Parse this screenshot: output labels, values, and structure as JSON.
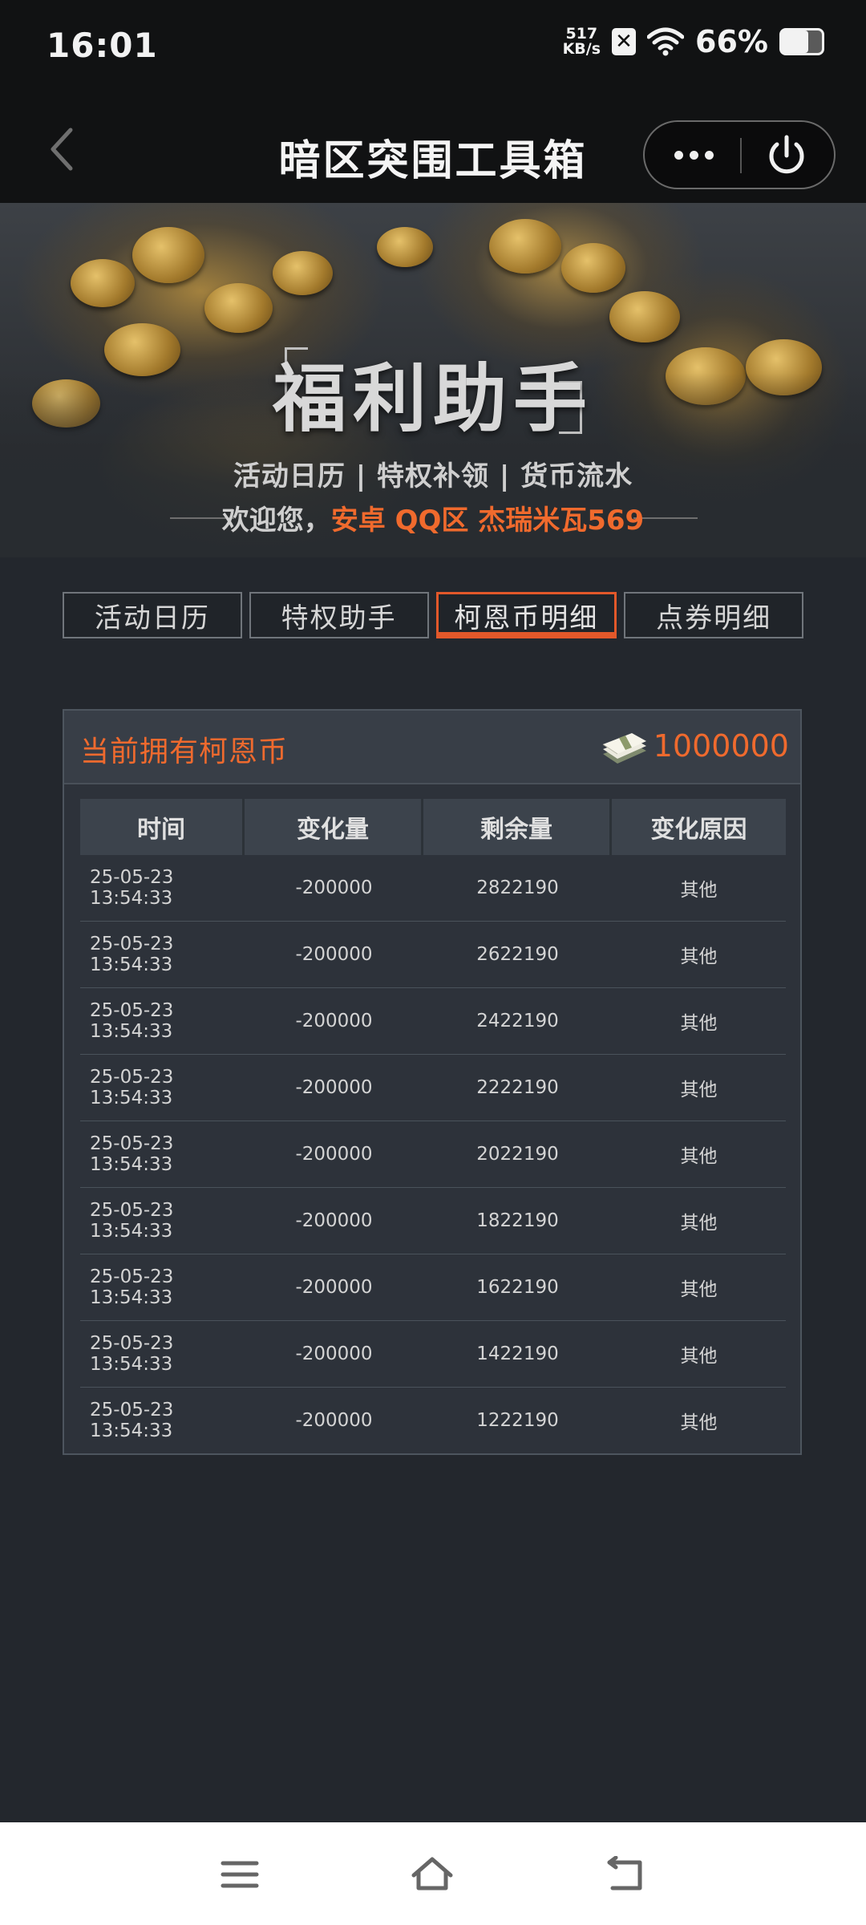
{
  "status_bar": {
    "time": "16:01",
    "net_speed_value": "517",
    "net_speed_unit": "KB/s",
    "battery_percent": "66%",
    "battery_level": 0.66,
    "icons": [
      "close-box-icon",
      "wifi-icon",
      "battery-icon"
    ]
  },
  "nav": {
    "title": "暗区突围工具箱",
    "icons": [
      "back-icon",
      "more-icon",
      "power-icon"
    ]
  },
  "banner": {
    "logo_text": "福利助手",
    "subtitle": "活动日历 | 特权补领 | 货币流水",
    "welcome_prefix": "欢迎您，",
    "welcome_highlight": "安卓 QQ区 杰瑞米瓦569"
  },
  "tabs": [
    {
      "label": "活动日历",
      "active": false
    },
    {
      "label": "特权助手",
      "active": false
    },
    {
      "label": "柯恩币明细",
      "active": true
    },
    {
      "label": "点券明细",
      "active": false
    }
  ],
  "panel": {
    "label": "当前拥有柯恩币",
    "amount": "1000000",
    "columns": [
      "时间",
      "变化量",
      "剩余量",
      "变化原因"
    ],
    "rows": [
      {
        "time": "25-05-23 13:54:33",
        "change": "-200000",
        "remaining": "2822190",
        "reason": "其他"
      },
      {
        "time": "25-05-23 13:54:33",
        "change": "-200000",
        "remaining": "2622190",
        "reason": "其他"
      },
      {
        "time": "25-05-23 13:54:33",
        "change": "-200000",
        "remaining": "2422190",
        "reason": "其他"
      },
      {
        "time": "25-05-23 13:54:33",
        "change": "-200000",
        "remaining": "2222190",
        "reason": "其他"
      },
      {
        "time": "25-05-23 13:54:33",
        "change": "-200000",
        "remaining": "2022190",
        "reason": "其他"
      },
      {
        "time": "25-05-23 13:54:33",
        "change": "-200000",
        "remaining": "1822190",
        "reason": "其他"
      },
      {
        "time": "25-05-23 13:54:33",
        "change": "-200000",
        "remaining": "1622190",
        "reason": "其他"
      },
      {
        "time": "25-05-23 13:54:33",
        "change": "-200000",
        "remaining": "1422190",
        "reason": "其他"
      },
      {
        "time": "25-05-23 13:54:33",
        "change": "-200000",
        "remaining": "1222190",
        "reason": "其他"
      }
    ]
  },
  "bottom_nav": {
    "icons": [
      "menu-icon",
      "home-icon",
      "back-arrow-icon"
    ]
  },
  "colors": {
    "accent": "#ef6a2e",
    "background": "#23272d",
    "bar": "#111213"
  }
}
